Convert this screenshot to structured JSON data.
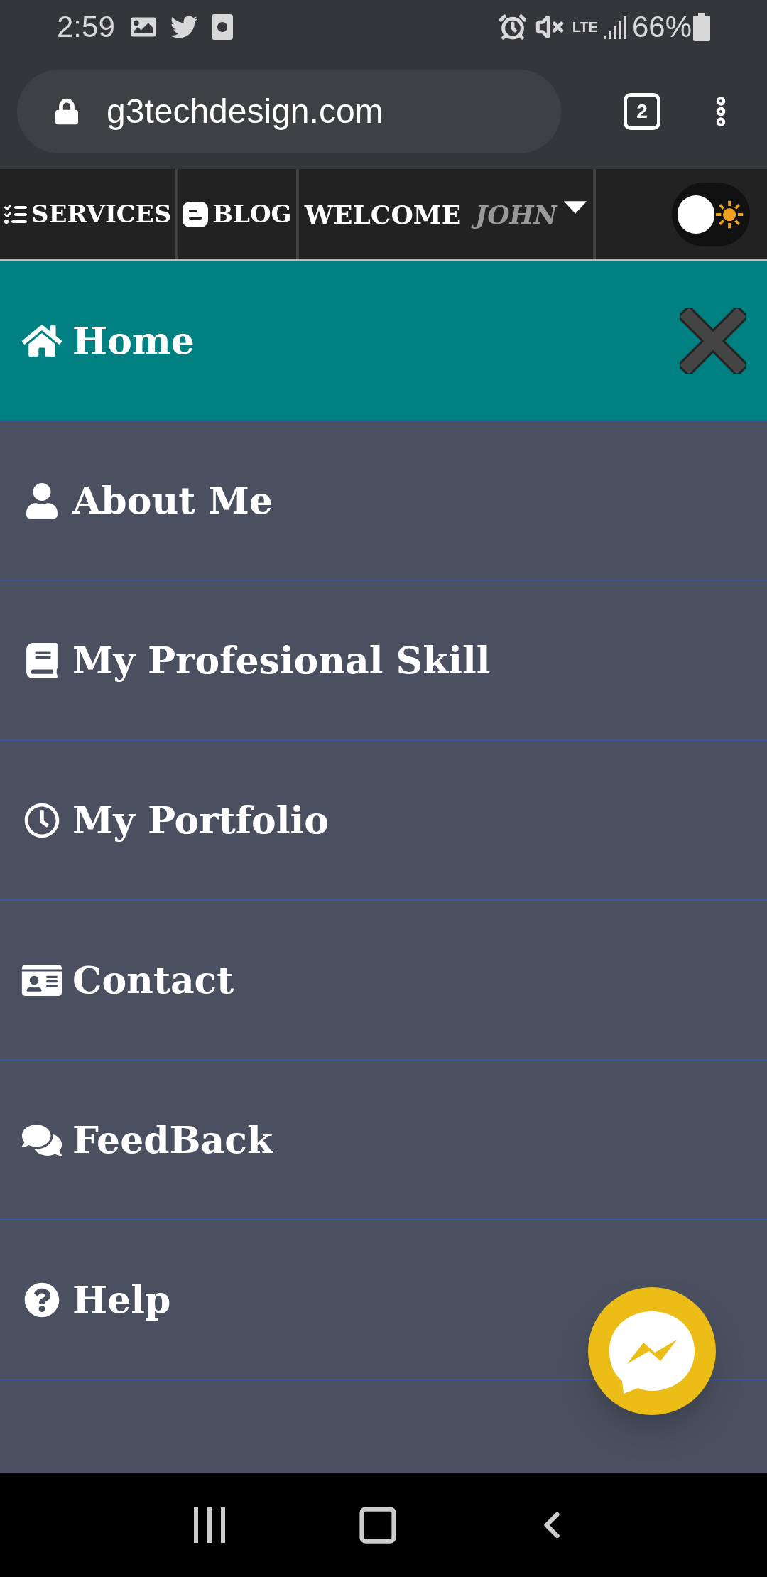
{
  "status_bar": {
    "time": "2:59",
    "network": "LTE",
    "battery": "66%"
  },
  "browser": {
    "url": "g3techdesign.com",
    "tab_count": "2"
  },
  "top_nav": {
    "items": [
      {
        "label": "SERVICES"
      },
      {
        "label": "BLOG"
      }
    ],
    "welcome": "WELCOME",
    "user": "JOHN",
    "theme_toggle": {
      "on": false
    }
  },
  "menu": {
    "items": [
      {
        "label": "Home",
        "selected": true
      },
      {
        "label": "About Me",
        "selected": false
      },
      {
        "label": "My Profesional Skill",
        "selected": false
      },
      {
        "label": "My Portfolio",
        "selected": false
      },
      {
        "label": "Contact",
        "selected": false
      },
      {
        "label": "FeedBack",
        "selected": false
      },
      {
        "label": "Help",
        "selected": false
      }
    ]
  }
}
